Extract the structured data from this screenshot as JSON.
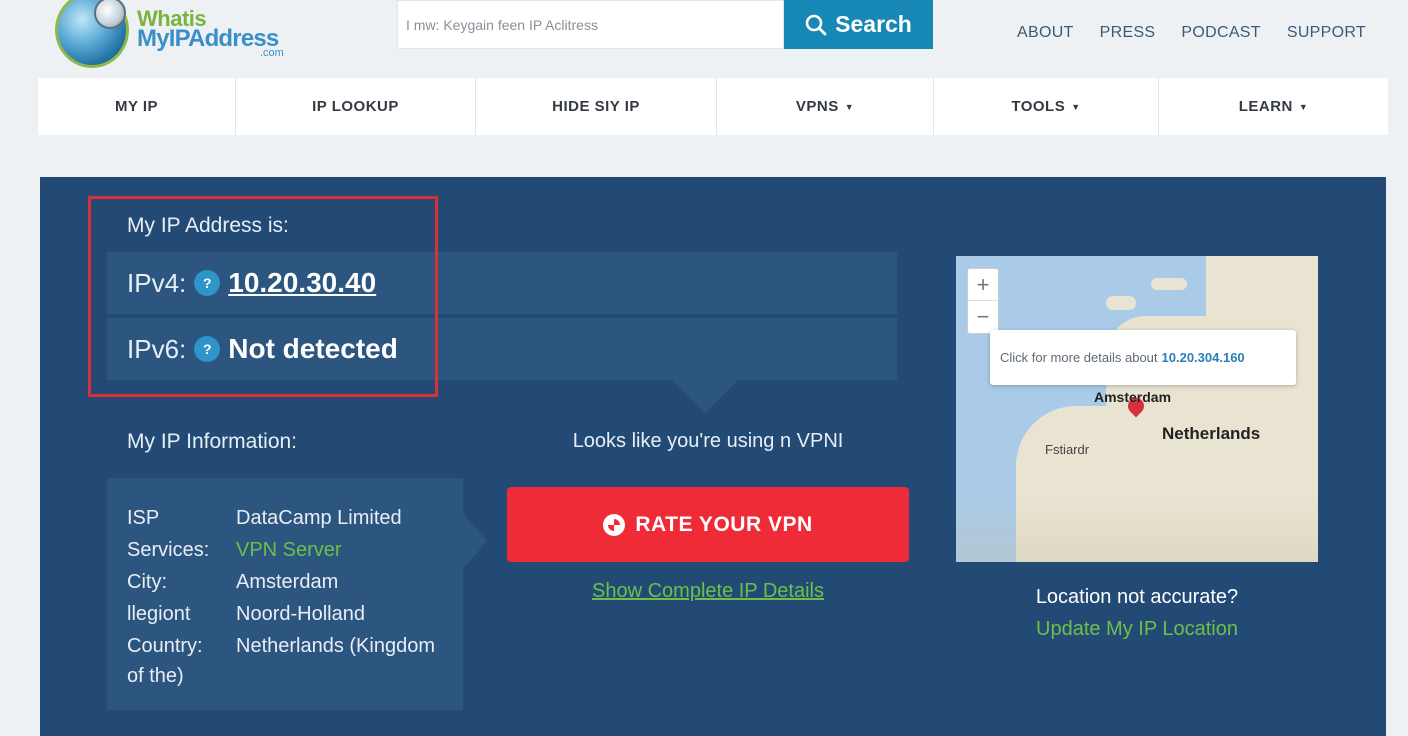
{
  "logo": {
    "line1": "Whatis",
    "line2": "MyIPAddress",
    "com": ".com"
  },
  "search": {
    "placeholder": "I mw: Keygain feen IP Aclitress",
    "button_label": "Search"
  },
  "top_links": [
    "ABOUT",
    "PRESS",
    "PODCAST",
    "SUPPORT"
  ],
  "nav": [
    "MY IP",
    "IP LOOKUP",
    "HIDE SIY IP",
    "VPNS",
    "TOOLS",
    "LEARN"
  ],
  "ip_card": {
    "label": "My IP Address is:",
    "ipv4_key": "IPv4:",
    "ipv4_value": "10.20.30.40",
    "ipv6_key": "IPv6:",
    "ipv6_value": "Not detected",
    "help_glyph": "?"
  },
  "info": {
    "title": "My IP Information:",
    "rows": [
      {
        "key": "ISP",
        "value": "DataCamp Limited"
      },
      {
        "key": "Services:",
        "value": "VPN Server"
      },
      {
        "key": "City:",
        "value": "Amsterdam"
      },
      {
        "key": "llegiont",
        "value": "Noord-Holland"
      },
      {
        "key": "Country:",
        "value": "Netherlands (Kingdom"
      }
    ],
    "country_cont": "of the)"
  },
  "vpn": {
    "notice": "Looks like you're using n VPNI",
    "rate_button": "RATE YOUR VPN",
    "details_link": "Show Complete IP Details"
  },
  "map": {
    "zoom_in": "+",
    "zoom_out": "−",
    "tooltip_text": "Click for more details about",
    "tooltip_ip": "10.20.304.160",
    "label_city": "Amsterdam",
    "label_country": "Netherlands",
    "label_rot": "Fstiardr"
  },
  "location": {
    "question": "Location not accurate?",
    "update_link": "Update My IP Location"
  },
  "colors": {
    "panel": "#234a75",
    "row": "#2c5580",
    "accent_blue": "#1787b5",
    "rate_red": "#ef2b38",
    "link_green": "#6cc04a",
    "frame_red": "#d6313b"
  }
}
